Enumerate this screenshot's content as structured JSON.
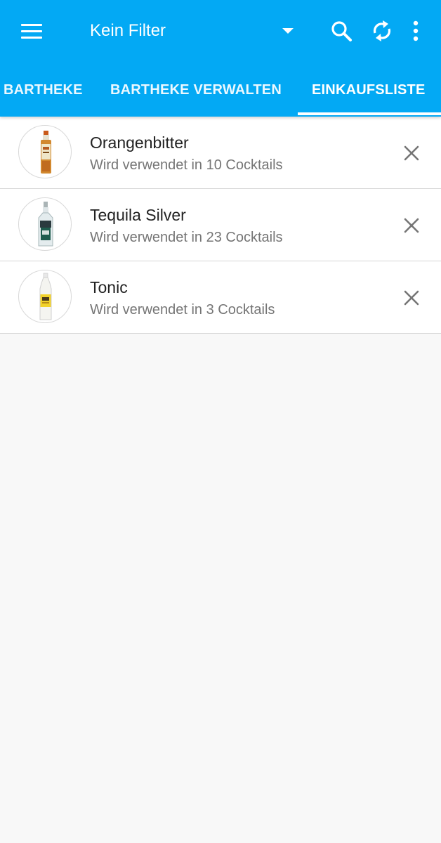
{
  "colors": {
    "primary": "#03a9f4",
    "on_primary": "#ffffff",
    "background": "#f8f8f8"
  },
  "toolbar": {
    "menu_icon": "hamburger-menu-icon",
    "filter_label": "Kein Filter",
    "dropdown_icon": "dropdown-arrow-icon",
    "search_icon": "search-icon",
    "sync_icon": "sync-icon",
    "more_icon": "more-vert-icon"
  },
  "tabs": [
    {
      "label": "BARTHEKE",
      "active": false
    },
    {
      "label": "BARTHEKE VERWALTEN",
      "active": false
    },
    {
      "label": "EINKAUFSLISTE",
      "active": true
    }
  ],
  "shopping_list": [
    {
      "name": "Orangenbitter",
      "subtitle": "Wird verwendet in 10 Cocktails",
      "image": "orange-bitters-bottle",
      "action_icon": "close-icon"
    },
    {
      "name": "Tequila Silver",
      "subtitle": "Wird verwendet in 23 Cocktails",
      "image": "tequila-bottle",
      "action_icon": "close-icon"
    },
    {
      "name": "Tonic",
      "subtitle": "Wird verwendet in 3 Cocktails",
      "image": "tonic-bottle",
      "action_icon": "close-icon"
    }
  ]
}
